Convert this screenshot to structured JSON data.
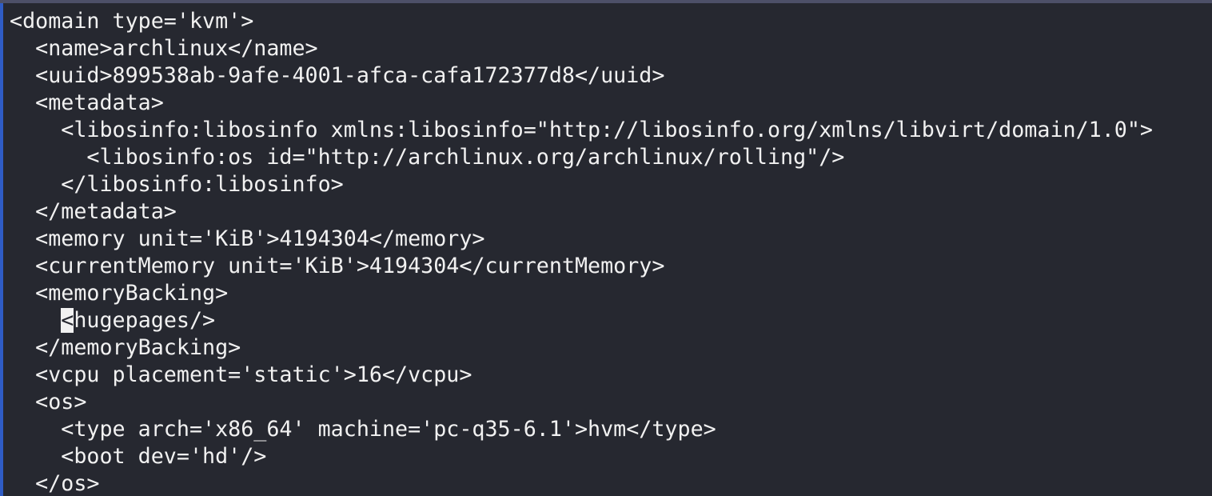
{
  "editor": {
    "lines": [
      "<domain type='kvm'>",
      "  <name>archlinux</name>",
      "  <uuid>899538ab-9afe-4001-afca-cafa172377d8</uuid>",
      "  <metadata>",
      "    <libosinfo:libosinfo xmlns:libosinfo=\"http://libosinfo.org/xmlns/libvirt/domain/1.0\">",
      "      <libosinfo:os id=\"http://archlinux.org/archlinux/rolling\"/>",
      "    </libosinfo:libosinfo>",
      "  </metadata>",
      "  <memory unit='KiB'>4194304</memory>",
      "  <currentMemory unit='KiB'>4194304</currentMemory>",
      "  <memoryBacking>",
      "    <hugepages/>",
      "  </memoryBacking>",
      "  <vcpu placement='static'>16</vcpu>",
      "  <os>",
      "    <type arch='x86_64' machine='pc-q35-6.1'>hvm</type>",
      "    <boot dev='hd'/>",
      "  </os>"
    ],
    "cursor": {
      "line": 11,
      "column": 4
    }
  }
}
